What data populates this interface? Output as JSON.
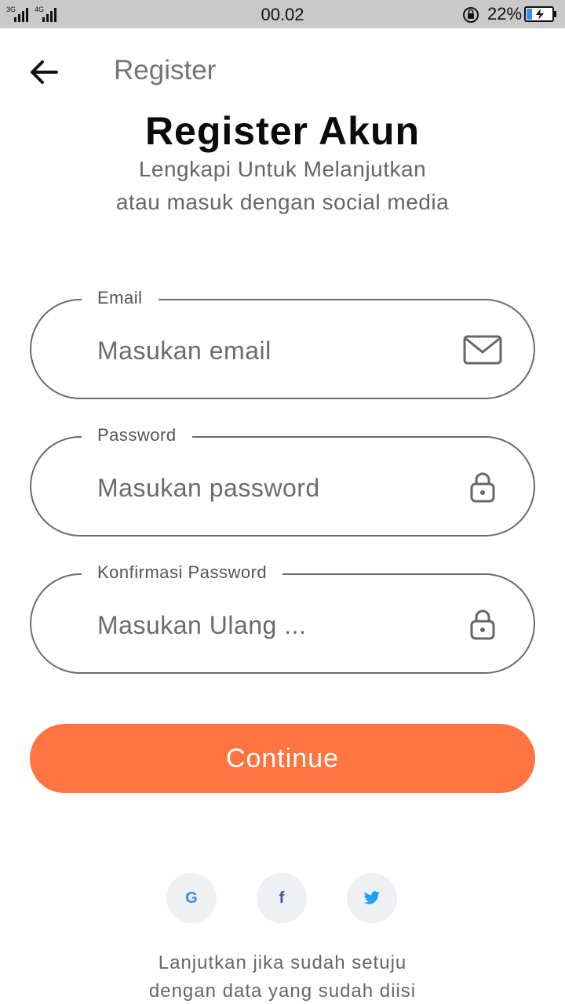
{
  "status_bar": {
    "network_left": "3G",
    "network_right": "4G",
    "time": "00.02",
    "battery_percent": "22%",
    "battery_level": 0.22,
    "icons": [
      "signal-icon",
      "rotation-lock-icon",
      "battery-charging-icon"
    ]
  },
  "app_bar": {
    "title": "Register",
    "back_icon": "arrow-left-icon"
  },
  "header": {
    "heading": "Register Akun",
    "subtitle_line1": "Lengkapi Untuk Melanjutkan",
    "subtitle_line2": "atau masuk dengan social media"
  },
  "form": {
    "email": {
      "label": "Email",
      "placeholder": "Masukan email",
      "value": "",
      "icon": "mail-icon"
    },
    "password": {
      "label": "Password",
      "placeholder": "Masukan password",
      "value": "",
      "icon": "lock-icon"
    },
    "confirm_password": {
      "label": "Konfirmasi Password",
      "placeholder": "Masukan Ulang ...",
      "value": "",
      "icon": "lock-icon"
    },
    "continue_label": "Continue"
  },
  "social": {
    "google": "G",
    "facebook": "f",
    "twitter_icon": "twitter-bird-icon"
  },
  "footer": {
    "line1": "Lanjutkan jika sudah setuju",
    "line2": "dengan data yang sudah diisi"
  },
  "colors": {
    "accent": "#ff7440",
    "status_bar": "#c9c9c9",
    "border": "#6a6a6a",
    "social_bg": "#eef0f3",
    "google": "#4285F4",
    "facebook": "#3b5998",
    "twitter": "#1da1f2"
  }
}
